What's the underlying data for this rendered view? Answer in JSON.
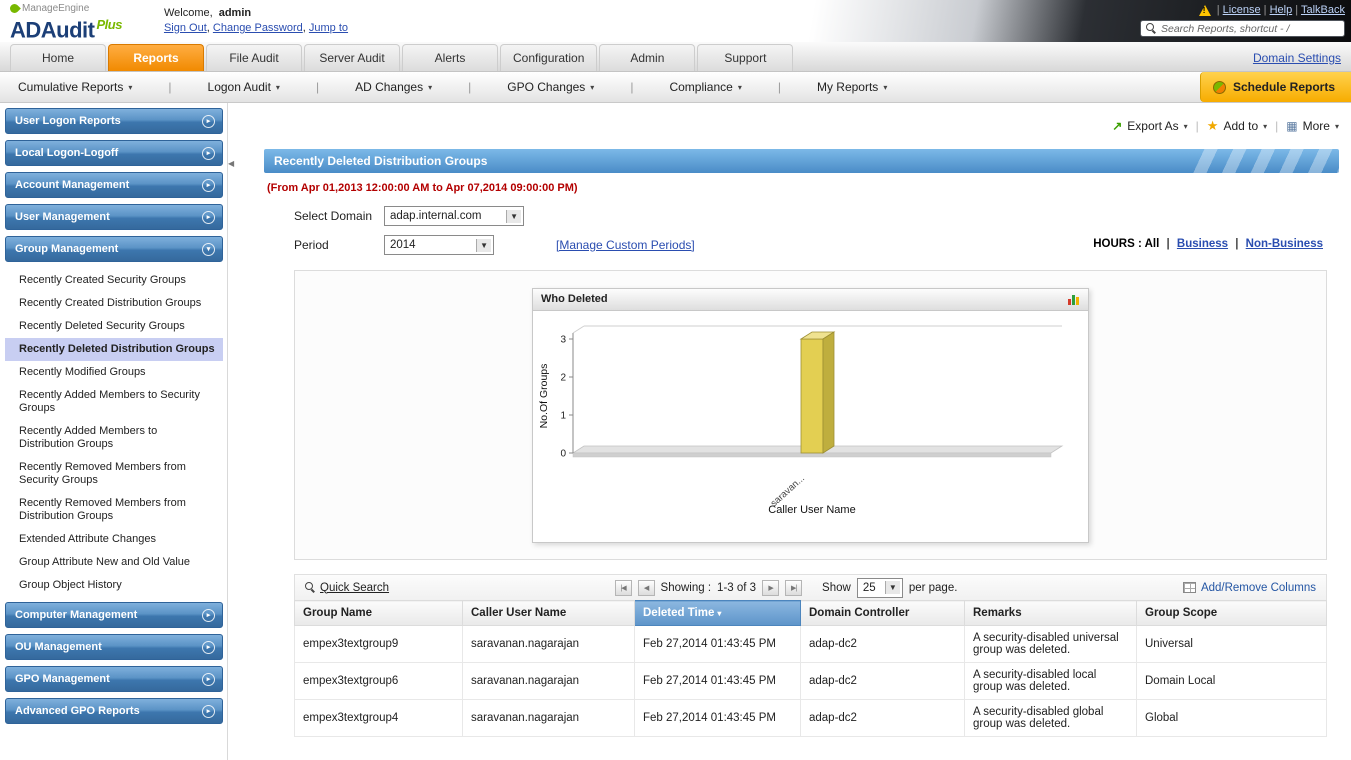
{
  "brand": {
    "manageengine": "ManageEngine",
    "product": "ADAudit",
    "plus": "Plus"
  },
  "header": {
    "welcome_prefix": "Welcome,",
    "username": "admin",
    "session_links": [
      "Sign Out",
      "Change Password",
      "Jump to"
    ],
    "utility_links": [
      "License",
      "Help",
      "TalkBack"
    ],
    "search_placeholder": "Search Reports, shortcut - /"
  },
  "tabs": {
    "items": [
      "Home",
      "Reports",
      "File Audit",
      "Server Audit",
      "Alerts",
      "Configuration",
      "Admin",
      "Support"
    ],
    "active": "Reports",
    "domain_settings_link": "Domain Settings"
  },
  "subnav": {
    "items": [
      "Cumulative Reports",
      "Logon Audit",
      "AD Changes",
      "GPO Changes",
      "Compliance",
      "My Reports"
    ],
    "schedule_reports": "Schedule Reports"
  },
  "sidebar": {
    "selected": "Recently Deleted Distribution Groups",
    "sections": [
      {
        "label": "User Logon Reports",
        "expanded": false
      },
      {
        "label": "Local Logon-Logoff",
        "expanded": false
      },
      {
        "label": "Account Management",
        "expanded": false
      },
      {
        "label": "User Management",
        "expanded": false
      },
      {
        "label": "Group Management",
        "expanded": true,
        "items": [
          "Recently Created Security Groups",
          "Recently Created Distribution Groups",
          "Recently Deleted Security Groups",
          "Recently Deleted Distribution Groups",
          "Recently Modified Groups",
          "Recently Added Members to Security Groups",
          "Recently Added Members to Distribution Groups",
          "Recently Removed Members from Security Groups",
          "Recently Removed Members from Distribution Groups",
          "Extended Attribute Changes",
          "Group Attribute New and Old Value",
          "Group Object History"
        ]
      },
      {
        "label": "Computer Management",
        "expanded": false
      },
      {
        "label": "OU Management",
        "expanded": false
      },
      {
        "label": "GPO Management",
        "expanded": false
      },
      {
        "label": "Advanced GPO Reports",
        "expanded": false
      }
    ]
  },
  "toolbar": {
    "export_as": "Export As",
    "add_to": "Add to",
    "more": "More"
  },
  "report": {
    "title": "Recently Deleted Distribution Groups",
    "period_note": "(From Apr 01,2013 12:00:00 AM to Apr 07,2014 09:00:00 PM)",
    "select_domain_label": "Select Domain",
    "domain_value": "adap.internal.com",
    "period_label": "Period",
    "period_value": "2014",
    "manage_custom_periods": "[Manage Custom Periods]",
    "hours_label": "HOURS :",
    "hours_all": "All",
    "hours_business": "Business",
    "hours_nonbusiness": "Non-Business"
  },
  "chart_data": {
    "type": "bar",
    "title": "Who Deleted",
    "categories": [
      "saravan..."
    ],
    "values": [
      3
    ],
    "xlabel": "Caller User Name",
    "ylabel": "No.Of Groups",
    "ylim": [
      0,
      3
    ],
    "yticks": [
      0,
      1,
      2,
      3
    ],
    "bar_color": "#e3cf52",
    "legend": false,
    "grid": false
  },
  "table": {
    "quick_search": "Quick Search",
    "paging": {
      "showing_label": "Showing :",
      "range": "1-3 of 3",
      "show_label": "Show",
      "page_size": "25",
      "per_page": "per page."
    },
    "add_remove_columns": "Add/Remove Columns",
    "columns": [
      "Group Name",
      "Caller User Name",
      "Deleted Time",
      "Domain Controller",
      "Remarks",
      "Group Scope"
    ],
    "sorted_column": "Deleted Time",
    "rows": [
      [
        "empex3textgroup9",
        "saravanan.nagarajan",
        "Feb 27,2014 01:43:45 PM",
        "adap-dc2",
        "A security-disabled universal group was deleted.",
        "Universal"
      ],
      [
        "empex3textgroup6",
        "saravanan.nagarajan",
        "Feb 27,2014 01:43:45 PM",
        "adap-dc2",
        "A security-disabled local group was deleted.",
        "Domain Local"
      ],
      [
        "empex3textgroup4",
        "saravanan.nagarajan",
        "Feb 27,2014 01:43:45 PM",
        "adap-dc2",
        "A security-disabled global group was deleted.",
        "Global"
      ]
    ]
  }
}
